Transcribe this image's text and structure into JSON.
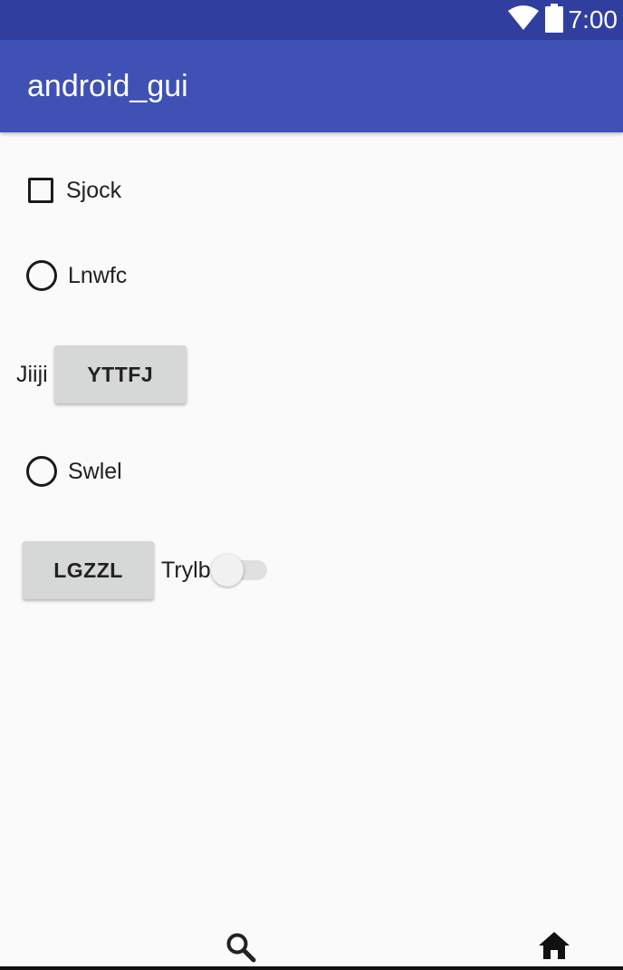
{
  "status_bar": {
    "time": "7:00",
    "icons": [
      "wifi-icon",
      "battery-icon"
    ]
  },
  "app_bar": {
    "title": "android_gui"
  },
  "main": {
    "checkbox": {
      "label": "Sjock",
      "checked": false
    },
    "radio_1": {
      "label": "Lnwfc",
      "checked": false
    },
    "labeled_button": {
      "label": "Jiiji",
      "button_label": "YTTFJ"
    },
    "radio_2": {
      "label": "Swlel",
      "checked": false
    },
    "button_switch": {
      "button_label": "LGZZL",
      "switch_label": "Trylb",
      "switch_on": false
    }
  },
  "bottom_nav": {
    "icons": [
      "search-icon",
      "home-icon"
    ]
  },
  "colors": {
    "status_bar": "#303f9f",
    "app_bar": "#3f51b5",
    "background": "#fafafa",
    "button": "#d6d7d7"
  }
}
